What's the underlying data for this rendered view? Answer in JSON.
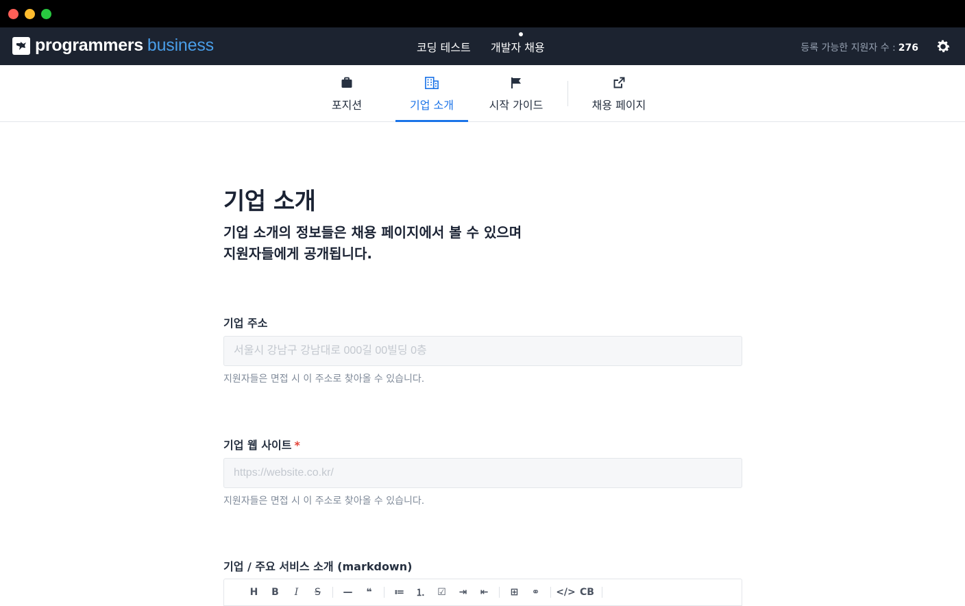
{
  "window": {
    "controls": [
      "close",
      "minimize",
      "maximize"
    ]
  },
  "topnav": {
    "brand_name": "programmers",
    "brand_sub": "business",
    "links": [
      {
        "label": "코딩 테스트"
      },
      {
        "label": "개발자 채용"
      }
    ],
    "applicants_label": "등록 가능한 지원자 수 :",
    "applicants_count": "276",
    "icons": [
      "logo-icon",
      "gear-icon"
    ]
  },
  "tabs": [
    {
      "label": "포지션",
      "icon": "briefcase-icon",
      "active": false
    },
    {
      "label": "기업 소개",
      "icon": "building-icon",
      "active": true
    },
    {
      "label": "시작 가이드",
      "icon": "flag-icon",
      "active": false
    },
    {
      "label": "채용 페이지",
      "icon": "external-link-icon",
      "active": false
    }
  ],
  "main": {
    "title": "기업 소개",
    "description_line1": "기업 소개의 정보들은 채용 페이지에서 볼 수 있으며",
    "description_line2": "지원자들에게 공개됩니다.",
    "address": {
      "label": "기업 주소",
      "placeholder": "서울시 강남구 강남대로 000길 00빌딩 0층",
      "value": "",
      "help": "지원자들은 면접 시 이 주소로 찾아올 수 있습니다."
    },
    "website": {
      "label": "기업 웹 사이트",
      "required_mark": "*",
      "placeholder": "https://website.co.kr/",
      "value": "",
      "help": "지원자들은 면접 시 이 주소로 찾아올 수 있습니다."
    },
    "intro": {
      "label": "기업 / 주요 서비스 소개 (markdown)",
      "toolbar": {
        "heading": "H",
        "bold": "B",
        "italic": "I",
        "strike": "S",
        "hr": "—",
        "quote": "❝",
        "ul": "≔",
        "ol": "⒈",
        "task": "☑",
        "indent": "⇥",
        "outdent": "⇤",
        "table": "⊞",
        "link": "⚭",
        "code": "</>",
        "codeblock": "CB"
      }
    }
  },
  "colors": {
    "nav_bg": "#1c2330",
    "accent": "#1a73e8",
    "brand_sub": "#4a9ee8",
    "required": "#e4453a"
  }
}
